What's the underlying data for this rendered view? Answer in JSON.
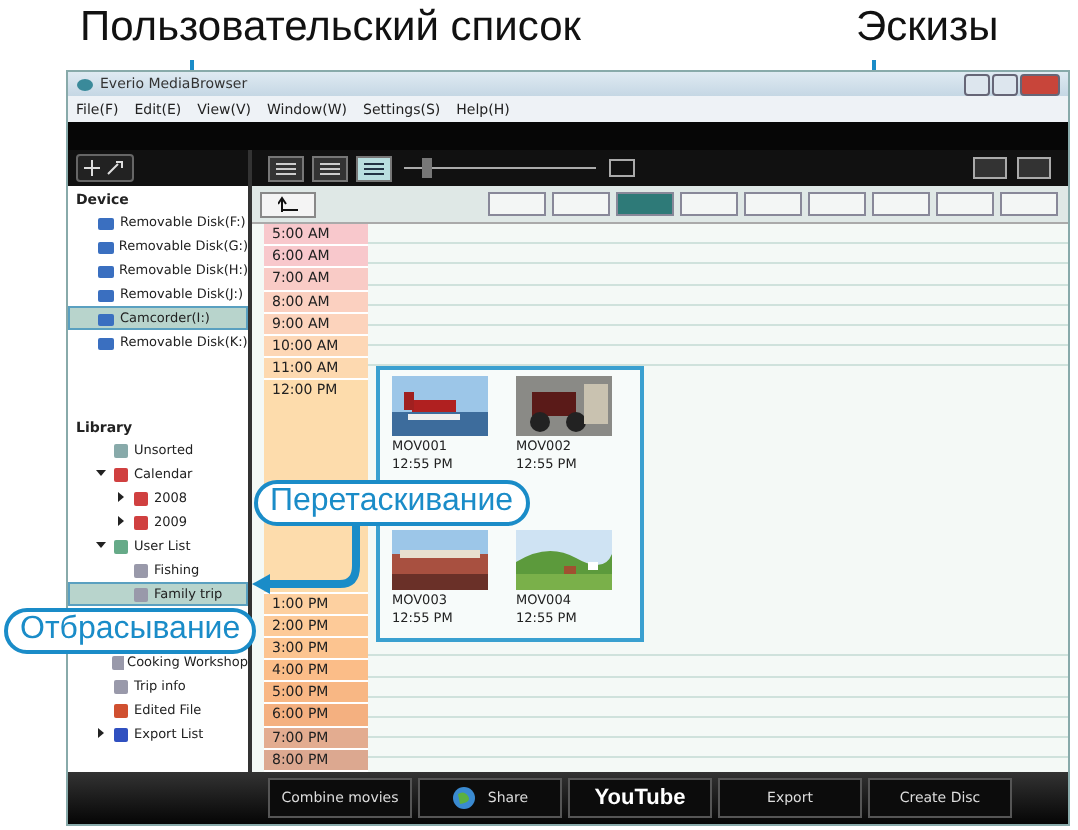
{
  "callouts": {
    "user_list": "Пользовательский список",
    "thumbnails": "Эскизы",
    "drag": "Перетаскивание",
    "drop": "Отбрасывание"
  },
  "window": {
    "title": "Everio MediaBrowser"
  },
  "menu": [
    "File(F)",
    "Edit(E)",
    "View(V)",
    "Window(W)",
    "Settings(S)",
    "Help(H)"
  ],
  "view_modes": [
    {
      "selected": false
    },
    {
      "selected": false
    },
    {
      "selected": true
    }
  ],
  "scale_buttons": [
    {
      "selected": false
    },
    {
      "selected": false
    },
    {
      "selected": true
    },
    {
      "selected": false
    },
    {
      "selected": false
    },
    {
      "selected": false
    },
    {
      "selected": false
    },
    {
      "selected": false
    },
    {
      "selected": false
    }
  ],
  "sidebar": {
    "device_heading": "Device",
    "devices": [
      {
        "label": "Removable Disk(F:)",
        "selected": false
      },
      {
        "label": "Removable Disk(G:)",
        "selected": false
      },
      {
        "label": "Removable Disk(H:)",
        "selected": false
      },
      {
        "label": "Removable Disk(J:)",
        "selected": false
      },
      {
        "label": "Camcorder(I:)",
        "selected": true
      },
      {
        "label": "Removable Disk(K:)",
        "selected": false
      }
    ],
    "library_heading": "Library",
    "library": [
      {
        "label": "Unsorted",
        "kind": "folder",
        "selected": false
      },
      {
        "label": "Calendar",
        "kind": "calendar",
        "expanded": true,
        "selected": false,
        "children": [
          {
            "label": "2008",
            "kind": "calendar",
            "expanded": false,
            "selected": false
          },
          {
            "label": "2009",
            "kind": "calendar",
            "expanded": false,
            "selected": false
          }
        ]
      },
      {
        "label": "User List",
        "kind": "list",
        "expanded": true,
        "selected": false,
        "children": [
          {
            "label": "Fishing",
            "kind": "user",
            "selected": false
          },
          {
            "label": "Family trip",
            "kind": "user",
            "selected": true
          }
        ]
      },
      {
        "label": "Cooking Workshop",
        "kind": "user",
        "selected": false
      },
      {
        "label": "Trip info",
        "kind": "user",
        "selected": false
      },
      {
        "label": "Edited File",
        "kind": "edited",
        "selected": false
      },
      {
        "label": "Export List",
        "kind": "export",
        "expanded": false,
        "selected": false
      }
    ]
  },
  "time_slots": [
    {
      "label": "5:00 AM",
      "color": "#f8c8cc"
    },
    {
      "label": "6:00 AM",
      "color": "#f8c8cc"
    },
    {
      "label": "7:00 AM",
      "color": "#f9cbc6"
    },
    {
      "label": "8:00 AM",
      "color": "#fbd0c0"
    },
    {
      "label": "9:00 AM",
      "color": "#fcd3bc"
    },
    {
      "label": "10:00 AM",
      "color": "#fdd7b6"
    },
    {
      "label": "11:00 AM",
      "color": "#fdd9b0"
    },
    {
      "label": "12:00 PM",
      "color": "#fddcac"
    },
    {
      "label": "1:00 PM",
      "color": "#fdd0a0"
    },
    {
      "label": "2:00 PM",
      "color": "#fdca98"
    },
    {
      "label": "3:00 PM",
      "color": "#fcc490"
    },
    {
      "label": "4:00 PM",
      "color": "#fbbd88"
    },
    {
      "label": "5:00 PM",
      "color": "#f8b784"
    },
    {
      "label": "6:00 PM",
      "color": "#f4b080"
    },
    {
      "label": "7:00 PM",
      "color": "#e3ac90"
    },
    {
      "label": "8:00 PM",
      "color": "#dca890"
    }
  ],
  "zoom_slider": {
    "level": 0.1
  },
  "thumbnails": [
    {
      "name": "MOV001",
      "time": "12:55 PM"
    },
    {
      "name": "MOV002",
      "time": "12:55 PM"
    },
    {
      "name": "MOV003",
      "time": "12:55 PM"
    },
    {
      "name": "MOV004",
      "time": "12:55 PM"
    }
  ],
  "bottom_buttons": [
    {
      "label": "Combine movies",
      "kind": "text"
    },
    {
      "label": "Share",
      "kind": "share"
    },
    {
      "label": "YouTube",
      "kind": "youtube"
    },
    {
      "label": "Export",
      "kind": "text"
    },
    {
      "label": "Create Disc",
      "kind": "text"
    }
  ]
}
